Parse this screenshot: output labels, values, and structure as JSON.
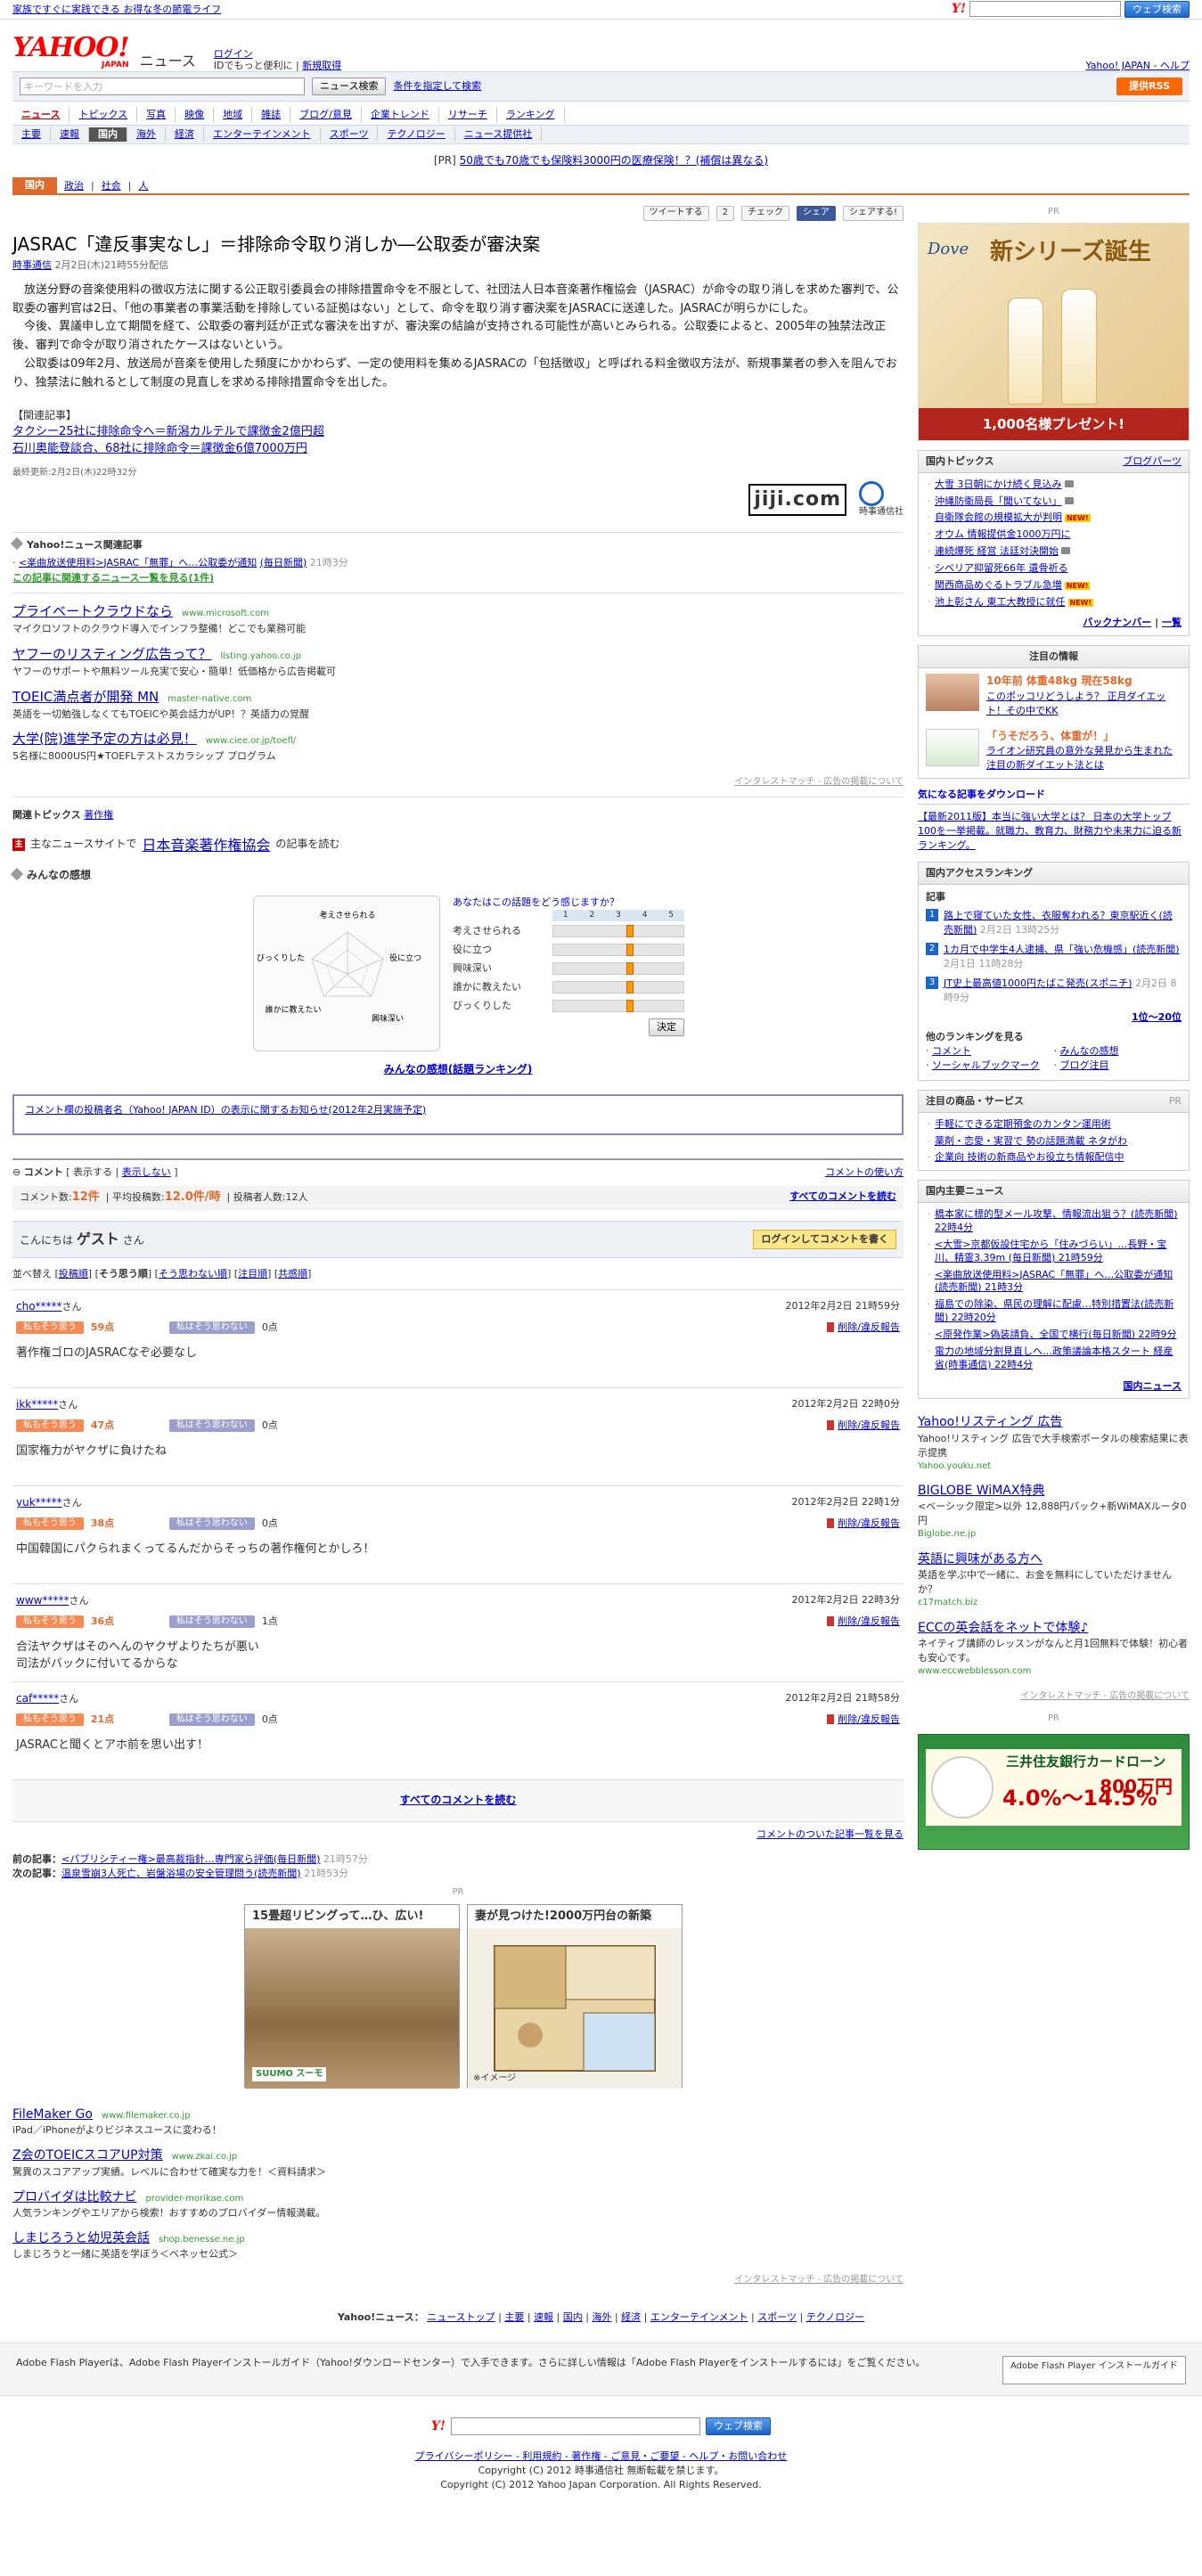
{
  "topbar": {
    "left_link": "家族ですぐに実践できる お得な冬の節電ライフ",
    "web_search_btn": "ウェブ検索",
    "home_help": "Yahoo! JAPAN - ヘルプ"
  },
  "header": {
    "logo": "YAHOO!",
    "logo_sub": "JAPAN",
    "service": "ニュース",
    "login": "ログイン",
    "login_note": "IDでもっと便利に",
    "signup": "新規取得"
  },
  "search": {
    "placeholder": "キーワードを入力",
    "button": "ニュース検索",
    "advanced": "条件を指定して検索",
    "rss": "提供RSS"
  },
  "nav1": [
    "ニュース",
    "トピックス",
    "写真",
    "映像",
    "地域",
    "雑誌",
    "ブログ/意見",
    "企業トレンド",
    "リサーチ",
    "ランキング"
  ],
  "nav2": [
    "主要",
    "速報",
    "国内",
    "海外",
    "経済",
    "エンターテインメント",
    "スポーツ",
    "テクノロジー",
    "ニュース提供社"
  ],
  "pr_line": {
    "prefix": "[PR]",
    "text": "50歳でも70歳でも保険料3000円の医療保険！？(補償は異なる)"
  },
  "cattabs": {
    "current": "国内",
    "items": [
      "政治",
      "社会",
      "人"
    ]
  },
  "share": {
    "tweet": "ツイートする",
    "tweet_count": "2",
    "check": "チェック",
    "fb": "シェア",
    "mixi": "シェアする!"
  },
  "article": {
    "headline": "JASRAC「違反事実なし」＝排除命令取り消しか―公取委が審決案",
    "source": "時事通信",
    "date": "2月2日(木)21時55分配信",
    "paragraphs": [
      "放送分野の音楽使用料の徴収方法に関する公正取引委員会の排除措置命令を不服として、社団法人日本音楽著作権協会（JASRAC）が命令の取り消しを求めた審判で、公取委の審判官は2日、「他の事業者の事業活動を排除している証拠はない」として、命令を取り消す審決案をJASRACに送達した。JASRACが明らかにした。",
      "今後、異議申し立て期間を経て、公取委の審判廷が正式な審決を出すが、審決案の結論が支持される可能性が高いとみられる。公取委によると、2005年の独禁法改正後、審判で命令が取り消されたケースはないという。",
      "公取委は09年2月、放送局が音楽を使用した頻度にかかわらず、一定の使用料を集めるJASRACの「包括徴収」と呼ばれる料金徴収方法が、新規事業者の参入を阻んでおり、独禁法に触れるとして制度の見直しを求める排除措置命令を出した。"
    ],
    "related_title": "【関連記事】",
    "related": [
      "タクシー25社に排除命令へ＝新潟カルテルで課徴金2億円超",
      "石川奥能登談合、68社に排除命令＝課徴金6億7000万円"
    ],
    "updated": "最終更新:2月2日(木)22時32分",
    "jiji": "jiji.com",
    "jiji_sub": "時事通信社"
  },
  "yrel": {
    "title": "Yahoo!ニュース関連記事",
    "item": "<楽曲放送使用料>JASRAC「無罪」へ…公取委が通知",
    "item_src": "(毎日新聞)",
    "item_time": "21時3分",
    "more": "この記事に関連するニュース一覧を見る(1件)"
  },
  "ads": [
    {
      "title": "プライベートクラウドなら",
      "url": "www.microsoft.com",
      "desc": "マイクロソフトのクラウド導入でインフラ整備！どこでも業務可能"
    },
    {
      "title": "ヤフーのリスティング広告って？",
      "url": "listing.yahoo.co.jp",
      "desc": "ヤフーのサポートや無料ツール充実で安心・簡単！低価格から広告掲載可"
    },
    {
      "title": "TOEIC満点者が開発 MN",
      "url": "master-native.com",
      "desc": "英語を一切勉強しなくてもTOEICや英会話力がUP！？英語力の覚醒"
    },
    {
      "title": "大学(院)進学予定の方は必見！",
      "url": "www.ciee.or.jp/toefl/",
      "desc": "5名様に8000US円★TOEFLテストスカラシップ プログラム"
    }
  ],
  "admatch": "インタレストマッチ - 広告の掲載について",
  "topics": {
    "label": "関連トピックス",
    "item": "著作権"
  },
  "readmore": {
    "pre": "主なニュースサイトで",
    "big": "日本音楽著作権協会",
    "post": "の記事を読む"
  },
  "feel": {
    "title": "みんなの感想",
    "question": "あなたはこの話題をどう感じますか？",
    "radar_labels": [
      "考えさせられる",
      "役に立つ",
      "興味深い",
      "誰かに教えたい",
      "びっくりした"
    ],
    "rows": [
      {
        "label": "考えさせられる",
        "level": 0.56
      },
      {
        "label": "役に立つ",
        "level": 0.56
      },
      {
        "label": "興味深い",
        "level": 0.56
      },
      {
        "label": "誰かに教えたい",
        "level": 0.56
      },
      {
        "label": "びっくりした",
        "level": 0.56
      }
    ],
    "scale": [
      "1",
      "2",
      "3",
      "4",
      "5"
    ],
    "decide": "決定",
    "link": "みんなの感想(話題ランキング)"
  },
  "notice": "コメント欄の投稿者名（Yahoo! JAPAN ID）の表示に関するお知らせ(2012年2月実施予定)",
  "comments": {
    "label": "コメント",
    "show": "表示する",
    "hide": "表示しない",
    "howto": "コメントの使い方",
    "count_label": "コメント数:",
    "count": "12件",
    "avg_label": "平均投稿数:",
    "avg": "12.0件/時",
    "posters": "投稿者人数:12人",
    "read_all": "すべてのコメントを読む",
    "greeting": "こんにちは",
    "guest": "ゲスト",
    "san": "さん",
    "login_btn": "ログインしてコメントを書く",
    "sort_label": "並べ替え",
    "sort": [
      "投稿順",
      "そう思う順",
      "そう思わない順",
      "注目順",
      "共感順"
    ],
    "agree": "私もそう思う",
    "disagree": "私はそう思わない",
    "report": "削除/違反報告",
    "list": [
      {
        "user": "cho*****",
        "time": "2012年2月2日 21時59分",
        "yes": "59点",
        "no": "0点",
        "text": "著作権ゴロのJASRACなぞ必要なし"
      },
      {
        "user": "ikk*****",
        "time": "2012年2月2日 22時0分",
        "yes": "47点",
        "no": "0点",
        "text": "国家権力がヤクザに負けたね"
      },
      {
        "user": "yuk*****",
        "time": "2012年2月2日 22時1分",
        "yes": "38点",
        "no": "0点",
        "text": "中国韓国にパクられまくってるんだからそっちの著作権何とかしろ！"
      },
      {
        "user": "www*****",
        "time": "2012年2月2日 22時3分",
        "yes": "36点",
        "no": "1点",
        "text": "合法ヤクザはそのへんのヤクザよりたちが悪い\n司法がバックに付いてるからな"
      },
      {
        "user": "caf*****",
        "time": "2012年2月2日 21時58分",
        "yes": "21点",
        "no": "0点",
        "text": "JASRACと聞くとアホ前を思い出す！"
      }
    ],
    "all_link": "すべてのコメントを読む",
    "list_link": "コメントのついた記事一覧を見る"
  },
  "prevnext": {
    "prev_label": "前の記事：",
    "prev": "<パブリシティー権>最高裁指針…専門家ら評価",
    "prev_src": "(毎日新聞)",
    "prev_time": "21時57分",
    "next_label": "次の記事：",
    "next": "温泉雪崩3人死亡、岩盤浴場の安全管理問う",
    "next_src": "(読売新聞)",
    "next_time": "21時53分"
  },
  "prads": {
    "pr": "PR",
    "a": "15畳超リビングって…ひ、広い!",
    "b": "妻が見つけた!2000万円台の新築",
    "a_logo": "SUUMO スーモ",
    "b_note": "※イメージ"
  },
  "footer_ads": [
    {
      "title": "FileMaker Go",
      "url": "www.filemaker.co.jp",
      "desc": "iPad／iPhoneがよりビジネスユースに変わる！"
    },
    {
      "title": "Z会のTOEICスコアUP対策",
      "url": "www.zkai.co.jp",
      "desc": "驚異のスコアアップ実績。レベルに合わせて確実な力を！＜資料請求＞"
    },
    {
      "title": "プロバイダは比較ナビ",
      "url": "provider-morikae.com",
      "desc": "人気ランキングやエリアから検索！おすすめのプロバイダー情報満載。"
    },
    {
      "title": "しまじろうと幼児英会話",
      "url": "shop.benesse.ne.jp",
      "desc": "しまじろうと一緒に英語を学ぼう＜ベネッセ公式＞"
    }
  ],
  "bnav": {
    "label": "Yahoo!ニュース：",
    "items": [
      "ニューストップ",
      "主要",
      "速報",
      "国内",
      "海外",
      "経済",
      "エンターテインメント",
      "スポーツ",
      "テクノロジー"
    ]
  },
  "flash": {
    "text": "Adobe Flash Playerは、Adobe Flash Playerインストールガイド（Yahoo!ダウンロードセンター）で入手できます。さらに詳しい情報は「Adobe Flash Playerをインストールするには」をご覧ください。",
    "btn": "Adobe Flash Player インストールガイド"
  },
  "footer": {
    "search_btn": "ウェブ検索",
    "links": "プライバシーポリシー - 利用規約 - 著作権 - ご意見・ご要望 - ヘルプ・お問い合わせ",
    "copy1": "Copyright (C) 2012 時事通信社 無断転載を禁じます。",
    "copy2": "Copyright (C) 2012 Yahoo Japan Corporation. All Rights Reserved."
  },
  "sidebar": {
    "pr": "PR",
    "dove_logo": "Dove",
    "dove_title": "新シリーズ誕生",
    "dove_bottom": "1,000名様プレゼント!",
    "topics_title": "国内トピックス",
    "topics_link": "ブログパーツ",
    "topics": [
      {
        "t": "大雪 3日朝にかけ続く見込み",
        "b": "cam"
      },
      {
        "t": "沖縄防衛局長「聞いてない」",
        "b": "cam"
      },
      {
        "t": "自衛隊会館の規模拡大が判明",
        "b": "new"
      },
      {
        "t": "オウム 情報提供金1000万円に",
        "b": ""
      },
      {
        "t": "連続爆死 経営 法廷対決開始",
        "b": "cam"
      },
      {
        "t": "シベリア抑留死66年 遺骨祈る",
        "b": ""
      },
      {
        "t": "関西商品めぐるトラブル急増",
        "b": "new"
      },
      {
        "t": "池上彰さん 東工大教授に就任",
        "b": "new"
      }
    ],
    "topics_back": "バックナンバー",
    "topics_list": "一覧",
    "notable_title": "注目の情報",
    "notable": [
      {
        "ttl": "10年前 体重48kg 現在58kg",
        "desc": "このポッコリどうしよう？ 正月ダイエット！その中でKK"
      },
      {
        "ttl": "「うそだろう、体重が！」",
        "desc": "ライオン研究員の意外な発見から生まれた注目の新ダイエット法とは"
      }
    ],
    "dl_title": "気になる記事をダウンロード",
    "dl_text": "【最新2011版】本当に強い大学とは？ 日本の大学トップ100を一挙掲載。就職力、教育力、財務力や未来力に迫る新ランキング。",
    "rank_title": "国内アクセスランキング",
    "rank_sub": "記事",
    "ranks": [
      {
        "t": "路上で寝ていた女性、衣服奪われる？東京駅近く",
        "s": "(読売新聞)",
        "d": "2月2日 13時25分"
      },
      {
        "t": "1カ月で中学生4人逮捕、県「強い危機感」",
        "s": "(読売新聞)",
        "d": "2月1日 11時28分"
      },
      {
        "t": "JT史上最高値1000円たばこ発売",
        "s": "(スポニチ)",
        "d": "2月2日 8時9分"
      }
    ],
    "rank_more": "1位〜20位",
    "other_title": "他のランキングを見る",
    "other": [
      "コメント",
      "みんなの感想",
      "ソーシャルブックマーク",
      "ブログ注目"
    ],
    "goods_title": "注目の商品・サービス",
    "goods": [
      "手軽にできる定期預金のカンタン運用術",
      "薬剤・恋愛・実習で 勢の話題満載 ネタがわ",
      "企業向 技術の新商品やお役立ち情報配信中"
    ],
    "major_title": "国内主要ニュース",
    "major": [
      "橋本家に標的型メール攻撃、情報流出狙う？(読売新聞) 22時4分",
      "<大雪>京都仮設住宅から「住みづらい」…長野・宝川、精霊3.39m (毎日新聞) 21時59分",
      "<楽曲放送使用料>JASRAC「無罪」へ…公取委が通知(読売新聞) 21時3分",
      "福島での除染、県民の理解に配慮…特別措置法(読売新聞) 22時20分",
      "<原発作業>偽装請負、全国で横行(毎日新聞) 22時9分",
      "電力の地域分割見直しへ…政策議論本格スタート 経産省(時事通信) 22時4分"
    ],
    "major_more": "国内ニュース",
    "txtads": [
      {
        "title": "Yahoo!リスティング 広告",
        "desc": "Yahoo!リスティング 広告で大手検索ポータルの検索結果に表示提携",
        "url": "Yahoo.youku.net"
      },
      {
        "title": "BIGLOBE WiMAX特典",
        "desc": "<ベーシック限定>以外 12,888円パック+新WiMAXルータ0円",
        "url": "Biglobe.ne.jp"
      },
      {
        "title": "英語に興味がある方へ",
        "desc": "英語を学ぶ中で一緒に、お金を無料にしていただけませんか？",
        "url": "ε17match.biz"
      },
      {
        "title": "ECCの英会話をネットで体験♪",
        "desc": "ネイティブ講師のレッスンがなんと月1回無料で体験！初心者も安心です。",
        "url": "www.eccwebblesson.com"
      }
    ],
    "admatch": "インタレストマッチ - 広告の掲載について",
    "bank_title": "三井住友銀行カードローン",
    "bank_rate": "4.0%〜14.5%",
    "bank_limit": "800万円"
  }
}
